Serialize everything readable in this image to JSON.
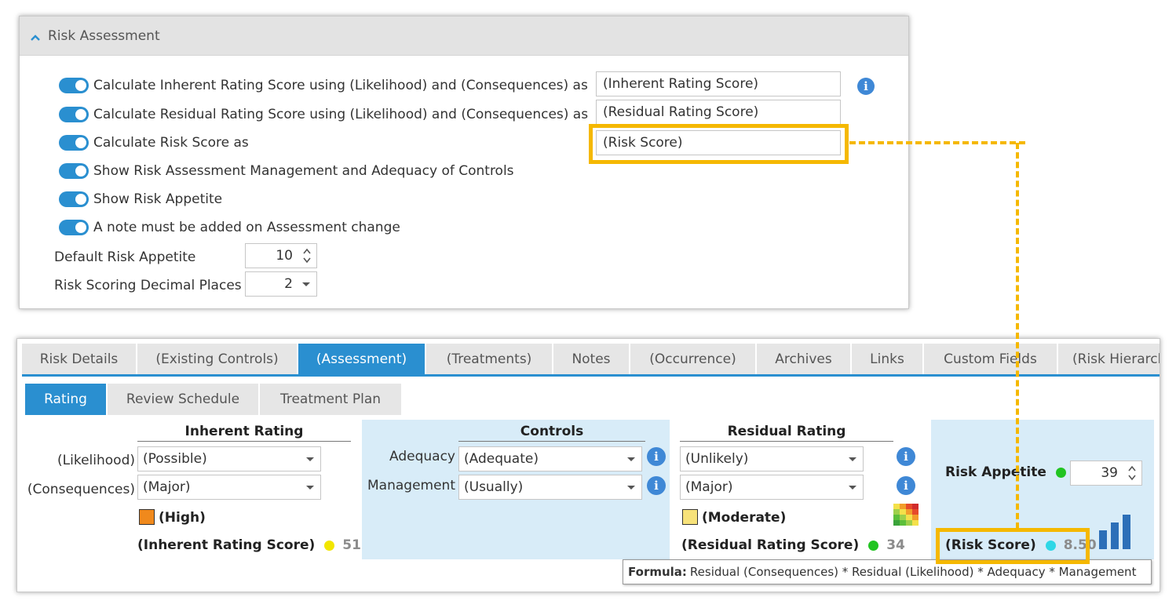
{
  "settings": {
    "header_title": "Risk Assessment",
    "options": [
      {
        "label": "Calculate Inherent Rating Score using (Likelihood) and (Consequences) as",
        "value": "(Inherent Rating Score)"
      },
      {
        "label": "Calculate Residual Rating Score using (Likelihood) and (Consequences) as",
        "value": "(Residual Rating Score)"
      },
      {
        "label": "Calculate Risk Score as",
        "value": "(Risk Score)"
      },
      {
        "label": "Show Risk Assessment Management and Adequacy of Controls"
      },
      {
        "label": "Show Risk Appetite"
      },
      {
        "label": "A note must be added on Assessment change"
      }
    ],
    "default_risk_appetite": {
      "label": "Default Risk Appetite",
      "value": "10"
    },
    "decimal_places": {
      "label": "Risk Scoring Decimal Places",
      "value": "2"
    }
  },
  "tabs": [
    {
      "label": "Risk Details"
    },
    {
      "label": "(Existing Controls)"
    },
    {
      "label": "(Assessment)"
    },
    {
      "label": "(Treatments)"
    },
    {
      "label": "Notes"
    },
    {
      "label": "(Occurrence)"
    },
    {
      "label": "Archives"
    },
    {
      "label": "Links"
    },
    {
      "label": "Custom Fields"
    },
    {
      "label": "(Risk Hierarchy)"
    }
  ],
  "subtabs": [
    {
      "label": "Rating"
    },
    {
      "label": "Review Schedule"
    },
    {
      "label": "Treatment Plan"
    }
  ],
  "inherent": {
    "title": "Inherent Rating",
    "likelihood_label": "(Likelihood)",
    "likelihood_value": "(Possible)",
    "consequences_label": "(Consequences)",
    "consequences_value": "(Major)",
    "rating": "(High)",
    "rating_color": "#f0891c",
    "score_label": "(Inherent Rating Score)",
    "score_dot_color": "#f2e600",
    "score_value": "51"
  },
  "controls": {
    "title": "Controls",
    "adequacy_label": "Adequacy",
    "adequacy_value": "(Adequate)",
    "management_label": "Management",
    "management_value": "(Usually)"
  },
  "residual": {
    "title": "Residual Rating",
    "likelihood_value": "(Unlikely)",
    "consequences_value": "(Major)",
    "rating": "(Moderate)",
    "rating_color": "#f7e27a",
    "score_label": "(Residual Rating Score)",
    "score_dot_color": "#22c422",
    "score_value": "34"
  },
  "appetite": {
    "label": "Risk Appetite",
    "dot_color": "#22c422",
    "value": "39",
    "risk_score_label": "(Risk Score)",
    "risk_score_dot_color": "#2fd7e6",
    "risk_score_value": "8.50"
  },
  "formula": {
    "label": "Formula:",
    "text": "Residual (Consequences) * Residual (Likelihood) * Adequacy * Management"
  },
  "colors": {
    "accent": "#2a8fd0",
    "highlight": "#f5b800",
    "info": "#3f88d6"
  }
}
